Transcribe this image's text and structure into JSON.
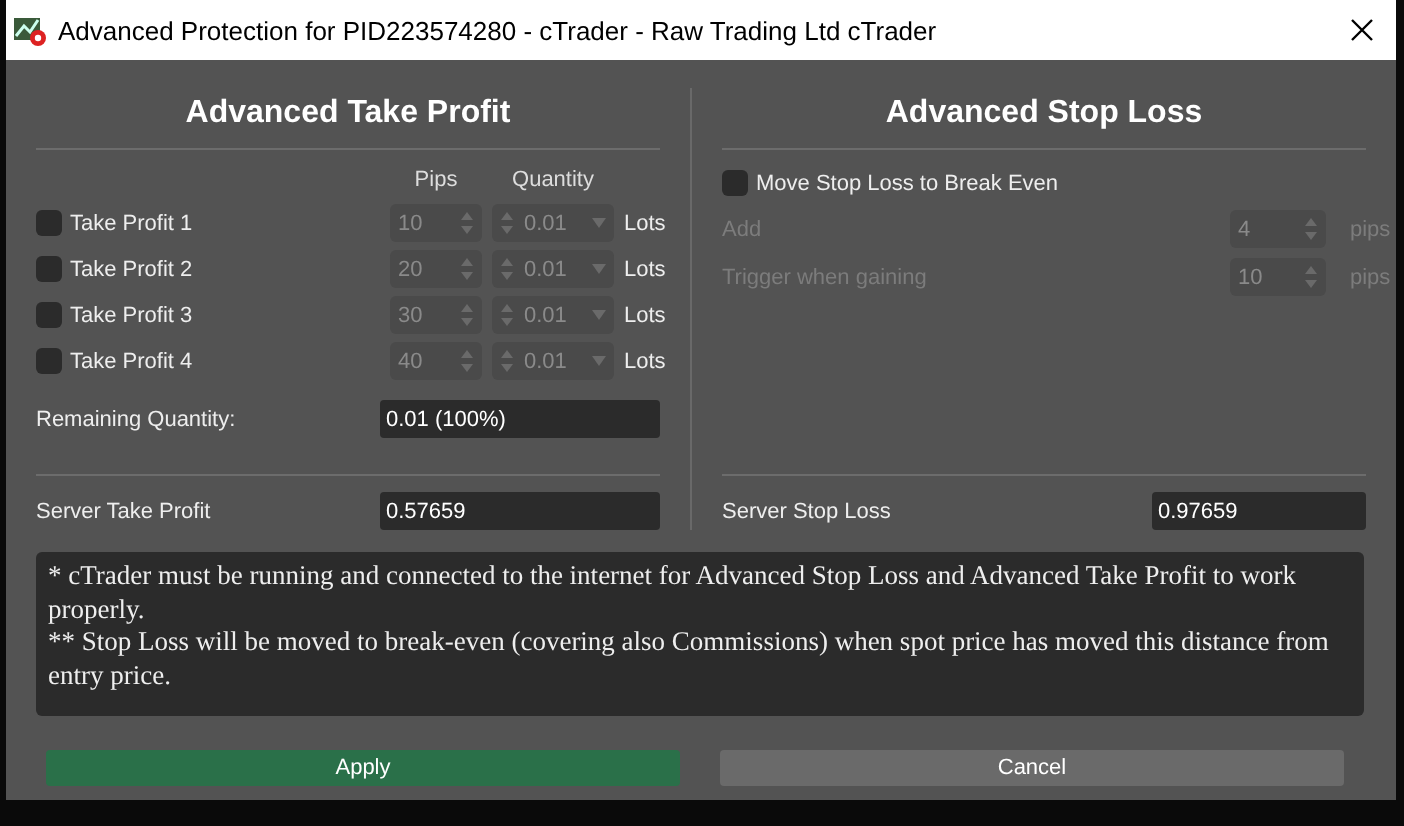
{
  "window": {
    "title": "Advanced Protection for PID223574280 - cTrader - Raw Trading Ltd cTrader"
  },
  "take_profit": {
    "heading": "Advanced Take Profit",
    "column_headers": [
      "Pips",
      "Quantity"
    ],
    "levels": [
      {
        "label": "Take Profit 1",
        "checked": false,
        "disabled": true,
        "pips": "10",
        "quantity": "0.01",
        "unit": "Lots"
      },
      {
        "label": "Take Profit 2",
        "checked": false,
        "disabled": true,
        "pips": "20",
        "quantity": "0.01",
        "unit": "Lots"
      },
      {
        "label": "Take Profit 3",
        "checked": false,
        "disabled": true,
        "pips": "30",
        "quantity": "0.01",
        "unit": "Lots"
      },
      {
        "label": "Take Profit 4",
        "checked": false,
        "disabled": true,
        "pips": "40",
        "quantity": "0.01",
        "unit": "Lots"
      }
    ],
    "remaining": {
      "label": "Remaining Quantity:",
      "value": "0.01 (100%)"
    },
    "server": {
      "label": "Server Take Profit",
      "value": "0.57659"
    }
  },
  "stop_loss": {
    "heading": "Advanced Stop Loss",
    "break_even": {
      "label": "Move Stop Loss to Break Even",
      "checked": false
    },
    "settings": [
      {
        "label": "Add",
        "value": "4",
        "unit": "pips",
        "disabled": true
      },
      {
        "label": "Trigger when gaining",
        "value": "10",
        "unit": "pips",
        "disabled": true
      }
    ],
    "server": {
      "label": "Server Stop Loss",
      "value": "0.97659"
    }
  },
  "notes": [
    "* cTrader must be running and connected to the internet for Advanced Stop Loss and Advanced Take Profit to work properly.",
    "** Stop Loss will be moved to break-even (covering also Commissions) when spot price has moved this distance from entry price."
  ],
  "buttons": [
    {
      "label": "Apply",
      "kind": "primary"
    },
    {
      "label": "Cancel",
      "kind": "secondary"
    }
  ]
}
